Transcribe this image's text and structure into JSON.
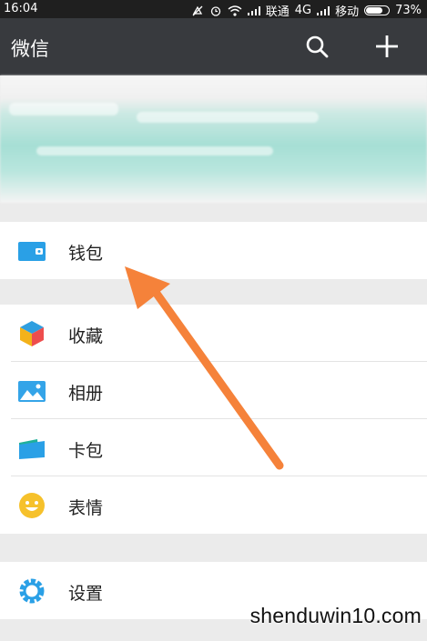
{
  "status_bar": {
    "time": "16:04",
    "carrier1": "联通",
    "network": "4G",
    "carrier2": "移动",
    "battery": "73%",
    "battery_level": 0.73
  },
  "app_bar": {
    "title": "微信",
    "search_icon": "search-icon",
    "add_icon": "plus-icon"
  },
  "menu": {
    "wallet": "钱包",
    "favorites": "收藏",
    "album": "相册",
    "card": "卡包",
    "sticker": "表情",
    "settings": "设置"
  },
  "colors": {
    "app_bar": "#383a3e",
    "wallet_icon": "#2aa0e6",
    "arrow": "#f5823a"
  },
  "watermark": "shenduwin10.com"
}
